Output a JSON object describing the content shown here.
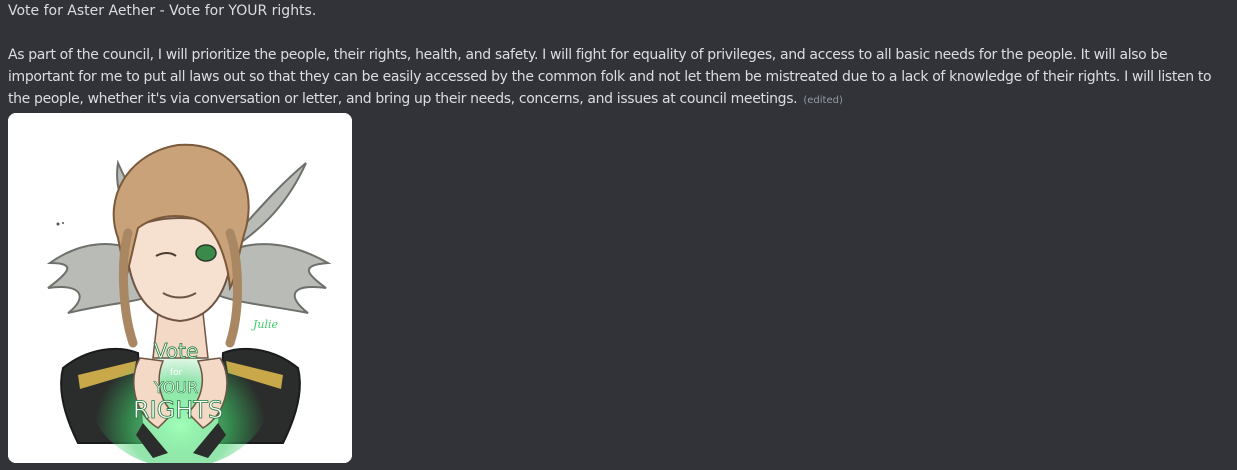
{
  "message": {
    "title": "Vote for Aster Aether - Vote for YOUR rights.",
    "body": "As part of the council, I will prioritize the people, their rights, health, and safety. I will fight for equality of privileges, and access to all basic needs for the people. It will also be important for me to put all laws out so that they can be easily accessed by the common folk and not let them be mistreated due to a lack of knowledge of their rights. I will listen to the people, whether it's via conversation or letter, and bring up their needs, concerns, and issues at council meetings.",
    "edited_label": "(edited)"
  },
  "attachment": {
    "poster_text": [
      "Vote",
      "for",
      "YOUR",
      "RIGHTS"
    ],
    "signature": "Julie"
  },
  "colors": {
    "background": "#313338",
    "text": "#dbdee1",
    "muted": "#949ba4",
    "accent_green": "#3ecf6a"
  }
}
